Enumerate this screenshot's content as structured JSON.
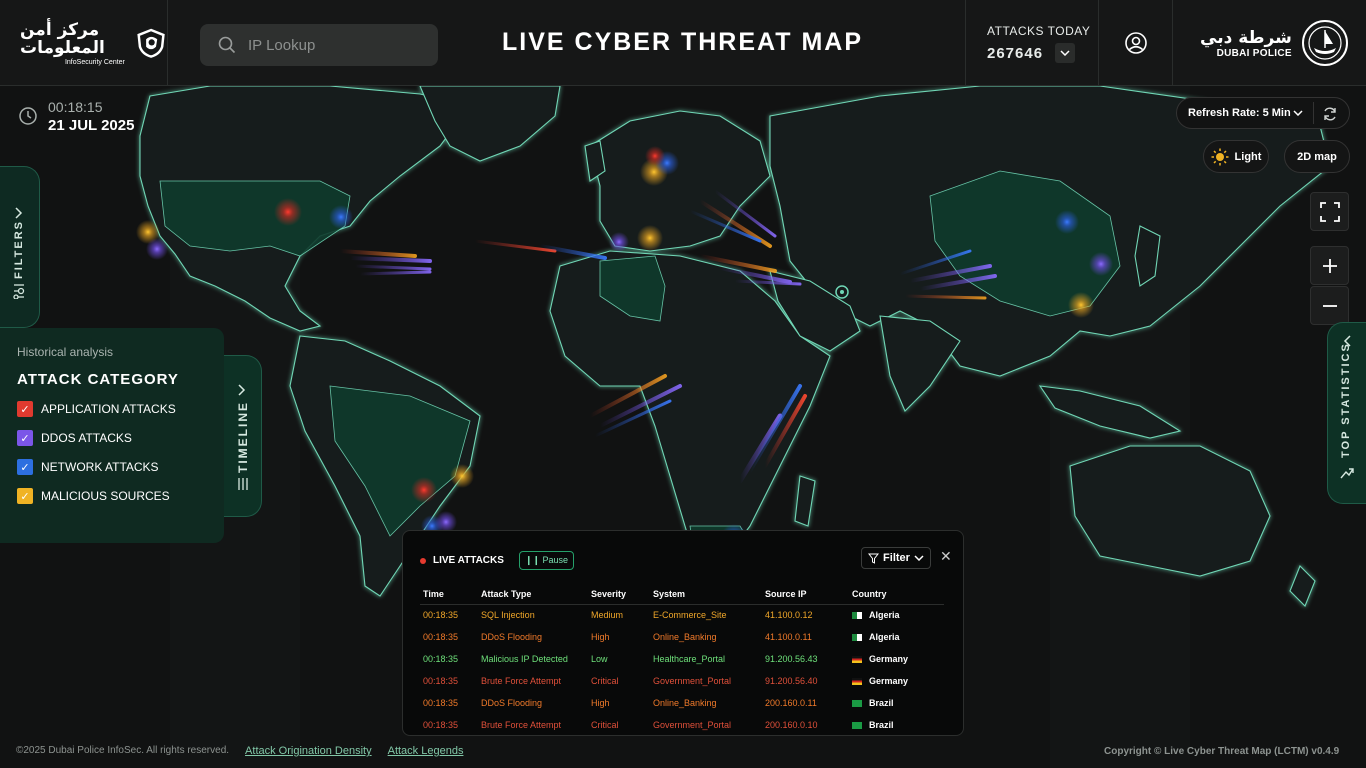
{
  "header": {
    "logo_ar": "مركز أمن المعلومات",
    "logo_en": "InfoSecurity Center",
    "search_placeholder": "IP Lookup",
    "title": "LIVE CYBER THREAT MAP",
    "attacks_today_label": "ATTACKS TODAY",
    "attacks_today_value": "267646",
    "police_ar": "شرطة دبي",
    "police_en": "DUBAI POLICE"
  },
  "clock": {
    "time": "00:18:15",
    "date": "21 JUL 2025"
  },
  "filters_tab": {
    "label": "FILTERS"
  },
  "timeline_tab": {
    "label": "TIMELINE"
  },
  "top_stats_tab": {
    "label": "TOP STATISTICS"
  },
  "category_panel": {
    "subtitle": "Historical analysis",
    "title": "ATTACK CATEGORY",
    "items": [
      {
        "label": "APPLICATION ATTACKS",
        "color": "#e03a2f"
      },
      {
        "label": "DDOS ATTACKS",
        "color": "#7b56e8"
      },
      {
        "label": "NETWORK ATTACKS",
        "color": "#2d6fe0"
      },
      {
        "label": "MALICIOUS SOURCES",
        "color": "#f0b324"
      }
    ]
  },
  "controls": {
    "refresh_label": "Refresh Rate: 5 Min",
    "light_label": "Light",
    "map_mode_label": "2D map"
  },
  "live_attacks": {
    "title": "LIVE ATTACKS",
    "pause_label": "Pause",
    "filter_label": "Filter",
    "columns": [
      "Time",
      "Attack Type",
      "Severity",
      "System",
      "Source IP",
      "Country"
    ],
    "rows": [
      {
        "time": "00:18:35",
        "type": "SQL Injection",
        "severity": "Medium",
        "system": "E-Commerce_Site",
        "ip": "41.100.0.12",
        "country": "Algeria",
        "color": "#f0a72a"
      },
      {
        "time": "00:18:35",
        "type": "DDoS Flooding",
        "severity": "High",
        "system": "Online_Banking",
        "ip": "41.100.0.11",
        "country": "Algeria",
        "color": "#f07a2a"
      },
      {
        "time": "00:18:35",
        "type": "Malicious IP Detected",
        "severity": "Low",
        "system": "Healthcare_Portal",
        "ip": "91.200.56.43",
        "country": "Germany",
        "color": "#6ee07a"
      },
      {
        "time": "00:18:35",
        "type": "Brute Force Attempt",
        "severity": "Critical",
        "system": "Government_Portal",
        "ip": "91.200.56.40",
        "country": "Germany",
        "color": "#e0503a"
      },
      {
        "time": "00:18:35",
        "type": "DDoS Flooding",
        "severity": "High",
        "system": "Online_Banking",
        "ip": "200.160.0.11",
        "country": "Brazil",
        "color": "#f07a2a"
      },
      {
        "time": "00:18:35",
        "type": "Brute Force Attempt",
        "severity": "Critical",
        "system": "Government_Portal",
        "ip": "200.160.0.10",
        "country": "Brazil",
        "color": "#e0503a"
      }
    ]
  },
  "footer": {
    "copyright": "©2025 Dubai Police InfoSec. All rights reserved.",
    "link1": "Attack Origination Density",
    "link2": "Attack Legends",
    "version": "Copyright © Live Cyber Threat Map (LCTM) v0.4.9"
  }
}
